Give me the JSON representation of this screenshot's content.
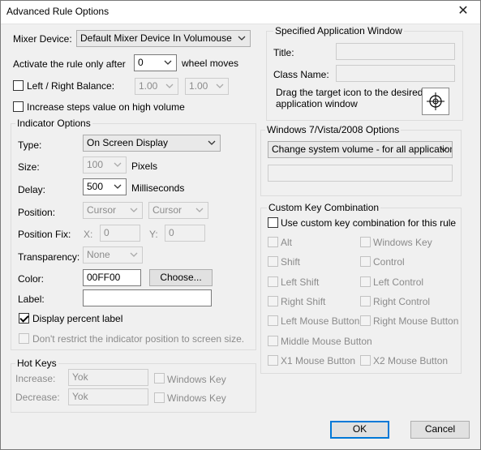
{
  "window": {
    "title": "Advanced Rule Options",
    "close_glyph": "✕"
  },
  "mixer": {
    "label": "Mixer Device:",
    "value": "Default Mixer Device In Volumouse"
  },
  "activate": {
    "label": "Activate the rule only after",
    "value": "0",
    "suffix": "wheel moves"
  },
  "balance": {
    "label": "Left / Right Balance:",
    "left": "1.00",
    "right": "1.00"
  },
  "increase_steps": {
    "label": "Increase steps value on high volume"
  },
  "indicator": {
    "group_title": "Indicator Options",
    "type_label": "Type:",
    "type_value": "On Screen Display",
    "size_label": "Size:",
    "size_value": "100",
    "size_unit": "Pixels",
    "delay_label": "Delay:",
    "delay_value": "500",
    "delay_unit": "Milliseconds",
    "position_label": "Position:",
    "position_x": "Cursor",
    "position_y": "Cursor",
    "posfix_label": "Position Fix:",
    "posfix_x_label": "X:",
    "posfix_x": "0",
    "posfix_y_label": "Y:",
    "posfix_y": "0",
    "transparency_label": "Transparency:",
    "transparency_value": "None",
    "color_label": "Color:",
    "color_value": "00FF00",
    "choose_label": "Choose...",
    "label_label": "Label:",
    "label_value": "",
    "display_percent_label": "Display percent label",
    "dont_restrict_label": "Don't restrict the indicator position to screen size."
  },
  "hotkeys": {
    "group_title": "Hot Keys",
    "increase_label": "Increase:",
    "increase_value": "Yok",
    "decrease_label": "Decrease:",
    "decrease_value": "Yok",
    "winkey_label": "Windows Key"
  },
  "app_window": {
    "group_title": "Specified Application Window",
    "title_label": "Title:",
    "title_value": "",
    "class_label": "Class Name:",
    "class_value": "",
    "drag_text_1": "Drag the target icon to the desired",
    "drag_text_2": "application window"
  },
  "win7": {
    "group_title": "Windows 7/Vista/2008 Options",
    "mode_value": "Change system volume - for all applications",
    "app_value": ""
  },
  "custom_keys": {
    "group_title": "Custom Key Combination",
    "use_label": "Use custom key combination for this rule",
    "left_col": [
      "Alt",
      "Shift",
      "Left Shift",
      "Right Shift",
      "Left Mouse Button",
      "Middle Mouse Button",
      "X1 Mouse Button"
    ],
    "right_col": [
      "Windows Key",
      "Control",
      "Left Control",
      "Right Control",
      "Right Mouse Button",
      "X2 Mouse Button"
    ]
  },
  "buttons": {
    "ok": "OK",
    "cancel": "Cancel"
  }
}
